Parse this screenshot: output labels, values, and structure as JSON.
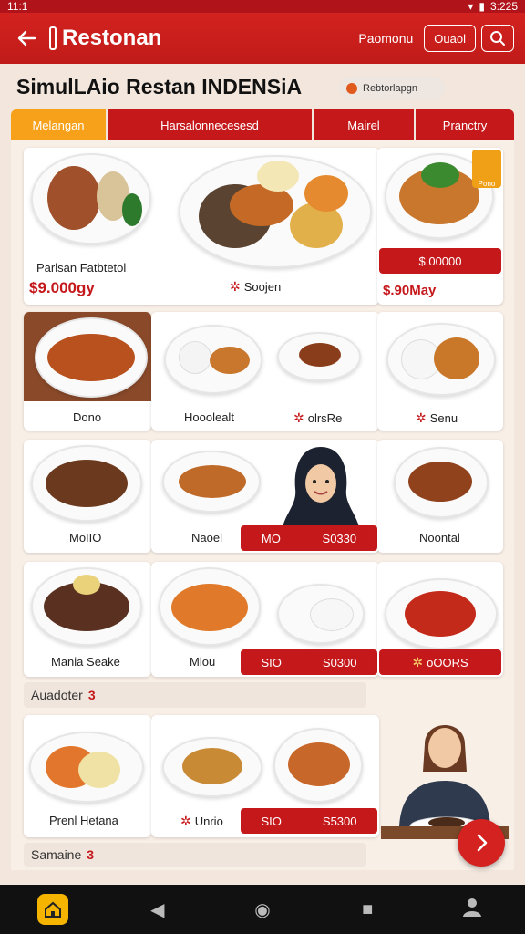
{
  "status_bar": {
    "time": "11:1",
    "clock": "3:225"
  },
  "app_bar": {
    "title": "Restonan",
    "link": "Paomonu",
    "chip": "Ouaol"
  },
  "page": {
    "title": "SimulLAio Restan INDENSiA",
    "chip": "Rebtorlapgn"
  },
  "tabs": [
    "Melangan",
    "Harsalonnecesesd",
    "Mairel",
    "Pranctry"
  ],
  "cards": {
    "c1": {
      "label": "Parlsan Fatbtetol",
      "price": "$9.000gy"
    },
    "c2": {
      "label": "Soojen"
    },
    "c3": {
      "button": "$.00000",
      "price": "$.90May",
      "badge": "Pono"
    },
    "c4": {
      "label": "Dono"
    },
    "c5": {
      "label": "Hooolealt"
    },
    "c6": {
      "label": "olrsRe"
    },
    "c7": {
      "label": "Senu"
    },
    "c8": {
      "label": "MoIIO"
    },
    "c9": {
      "label": "Naoel"
    },
    "c10": {
      "button_left": "MO",
      "button_right": "S0330"
    },
    "c11": {
      "label": "Noontal"
    },
    "c12": {
      "label": "Mania Seake"
    },
    "c13": {
      "label": "Mlou"
    },
    "c14": {
      "button_left": "SIO",
      "button_right": "S0300"
    },
    "c15": {
      "label": "oOORS"
    },
    "c16": {
      "label": "Prenl Hetana"
    },
    "c17": {
      "label": "Unrio"
    },
    "c18": {
      "button_left": "SIO",
      "button_right": "S5300"
    }
  },
  "sections": [
    {
      "label": "Auadoter",
      "num": "3"
    },
    {
      "label": "Samaine",
      "num": "3"
    }
  ],
  "colors": {
    "primary": "#c5181b",
    "accent": "#f7a11b",
    "background": "#f3e6dc"
  }
}
